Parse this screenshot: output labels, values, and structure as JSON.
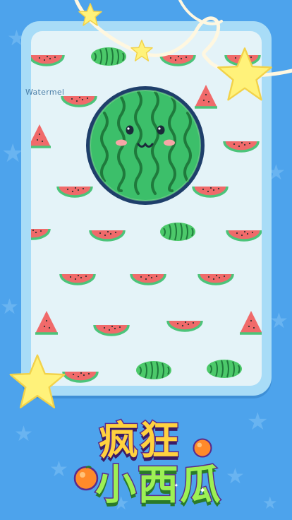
{
  "scene": {
    "caption": "Watermel",
    "title_line1": "疯狂",
    "title_line2": "小西瓜"
  },
  "colors": {
    "background": "#4da3ec",
    "card_frame": "#a8dcf7",
    "card_panel": "#e4f3f8",
    "watermelon_green": "#3cbf6a",
    "watermelon_dark": "#1f7a3c",
    "watermelon_red": "#f06a6a",
    "star_yellow": "#fff27a"
  },
  "icons": {
    "hero": "watermelon-face-icon",
    "decor": "star-icon",
    "logo_fruits": "orange-icon"
  }
}
